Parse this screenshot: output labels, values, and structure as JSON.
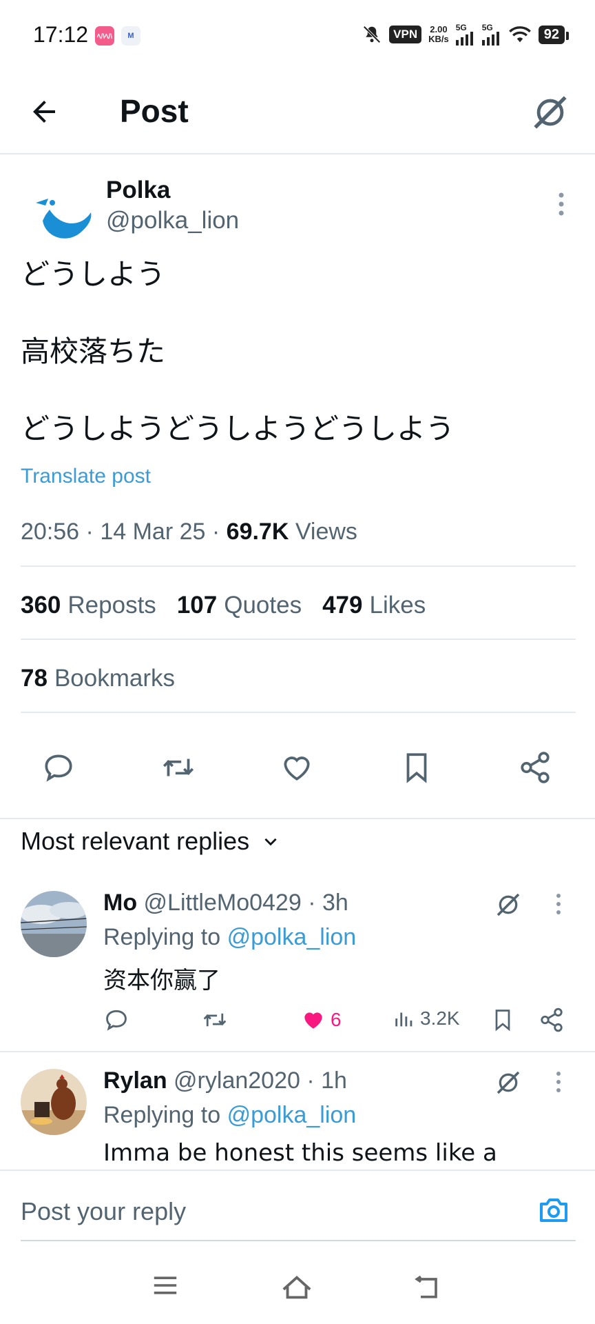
{
  "status": {
    "time": "17:12",
    "vpn": "VPN",
    "speed_value": "2.00",
    "speed_unit": "KB/s",
    "net1": "5G",
    "net2": "5G",
    "battery": "92",
    "icons": [
      "app-icon-1",
      "mail-app-icon",
      "mute-icon",
      "signal-icon",
      "wifi-icon",
      "battery-icon"
    ]
  },
  "header": {
    "title": "Post"
  },
  "post": {
    "author_name": "Polka",
    "author_handle": "@polka_lion",
    "lines": [
      "どうしよう",
      "高校落ちた",
      "どうしようどうしようどうしよう"
    ],
    "translate": "Translate post",
    "time": "20:56",
    "date": "14 Mar 25",
    "views_count": "69.7K",
    "views_label": "Views",
    "reposts_count": "360",
    "reposts_label": "Reposts",
    "quotes_count": "107",
    "quotes_label": "Quotes",
    "likes_count": "479",
    "likes_label": "Likes",
    "bookmarks_count": "78",
    "bookmarks_label": "Bookmarks"
  },
  "replies_section": {
    "label": "Most relevant replies"
  },
  "replies": [
    {
      "name": "Mo",
      "handle": "@LittleMo0429",
      "age": "3h",
      "replying_to_label": "Replying to",
      "replying_to": "@polka_lion",
      "text": "资本你赢了",
      "likes": "6",
      "views": "3.2K"
    },
    {
      "name": "Rylan",
      "handle": "@rylan2020",
      "age": "1h",
      "replying_to_label": "Replying to",
      "replying_to": "@polka_lion",
      "text": "Imma be honest this seems like a"
    }
  ],
  "reply_box": {
    "placeholder": "Post your reply"
  },
  "colors": {
    "link": "#3a9bd5",
    "like": "#f91880",
    "muted": "#536471",
    "text": "#0f1419"
  }
}
